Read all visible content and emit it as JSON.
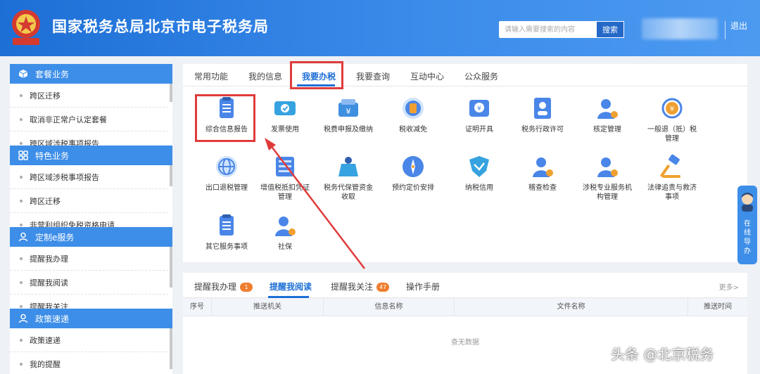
{
  "header": {
    "title": "国家税务总局北京市电子税务局",
    "search_placeholder": "请输入需要搜索的内容",
    "search_button": "搜索",
    "logout": "退出"
  },
  "sidebar": {
    "sections": [
      {
        "title": "套餐业务",
        "icon": "cube-icon",
        "items": [
          "跨区迁移",
          "取消非正常户认定套餐",
          "跨区域涉税事项报告"
        ]
      },
      {
        "title": "特色业务",
        "icon": "grid-icon",
        "items": [
          "跨区域涉税事项报告",
          "跨区迁移",
          "非营利组织免税资格申请"
        ]
      },
      {
        "title": "定制e服务",
        "icon": "user-icon",
        "items": [
          "提醒我办理",
          "提醒我阅读",
          "提醒我关注"
        ]
      },
      {
        "title": "政策速递",
        "icon": "user-icon",
        "items": [
          "政策速递",
          "我的提醒"
        ]
      }
    ]
  },
  "main_tabs": [
    "常用功能",
    "我的信息",
    "我要办税",
    "我要查询",
    "互动中心",
    "公众服务"
  ],
  "active_tab": "我要办税",
  "services": [
    [
      "综合信息报告"
    ],
    [
      "发票使用"
    ],
    [
      "税费申报及缴纳"
    ],
    [
      "税收减免"
    ],
    [
      "证明开具"
    ],
    [
      "税务行政许可"
    ],
    [
      "核定管理"
    ],
    [
      "一般退（抵）税",
      "管理"
    ],
    [
      "出口退税管理"
    ],
    [
      "增值税抵扣凭证",
      "管理"
    ],
    [
      "税务代保管资金",
      "收取"
    ],
    [
      "预约定价安排"
    ],
    [
      "纳税信用"
    ],
    [
      "稽查检查"
    ],
    [
      "涉税专业服务机",
      "构管理"
    ],
    [
      "法律追责与救济",
      "事项"
    ],
    [
      "其它服务事项"
    ],
    [
      "社保"
    ]
  ],
  "bottom_tabs": [
    {
      "label": "提醒我办理",
      "badge": "1"
    },
    {
      "label": "提醒我阅读",
      "badge": ""
    },
    {
      "label": "提醒我关注",
      "badge": "47"
    },
    {
      "label": "操作手册",
      "badge": ""
    }
  ],
  "more": "更多>",
  "table_headers": [
    "序号",
    "推送机关",
    "信息名称",
    "文件名称",
    "推送时间"
  ],
  "no_data": "查无数据",
  "float_help": "在线导办",
  "watermark": "头条 @北京税务",
  "colors": {
    "header_blue": "#1d6fd6",
    "menu_blue": "#3d8ee8",
    "highlight_red": "#e03b3b",
    "badge_orange": "#f07d2e"
  }
}
